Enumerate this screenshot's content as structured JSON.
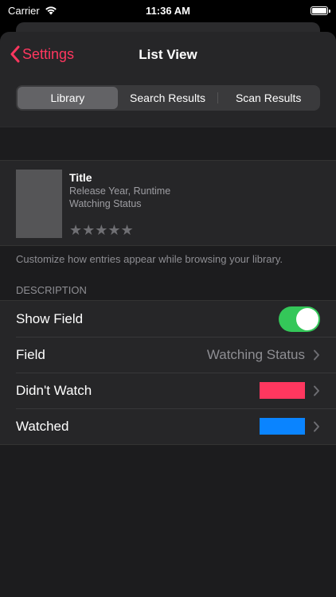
{
  "status": {
    "carrier": "Carrier",
    "time": "11:36 AM"
  },
  "nav": {
    "back_label": "Settings",
    "title": "List View"
  },
  "segments": [
    {
      "label": "Library",
      "active": true
    },
    {
      "label": "Search Results",
      "active": false
    },
    {
      "label": "Scan Results",
      "active": false
    }
  ],
  "preview": {
    "title": "Title",
    "line1": "Release Year, Runtime",
    "line2": "Watching Status",
    "stars": "★★★★★"
  },
  "footer_note": "Customize how entries appear while browsing your library.",
  "section_header": "DESCRIPTION",
  "rows": {
    "show_field": {
      "label": "Show Field",
      "on": true
    },
    "field": {
      "label": "Field",
      "value": "Watching Status"
    },
    "didnt_watch": {
      "label": "Didn't Watch",
      "color": "#ff375f"
    },
    "watched": {
      "label": "Watched",
      "color": "#0a84ff"
    }
  },
  "colors": {
    "accent": "#ff375f",
    "toggle_on": "#34c759"
  }
}
